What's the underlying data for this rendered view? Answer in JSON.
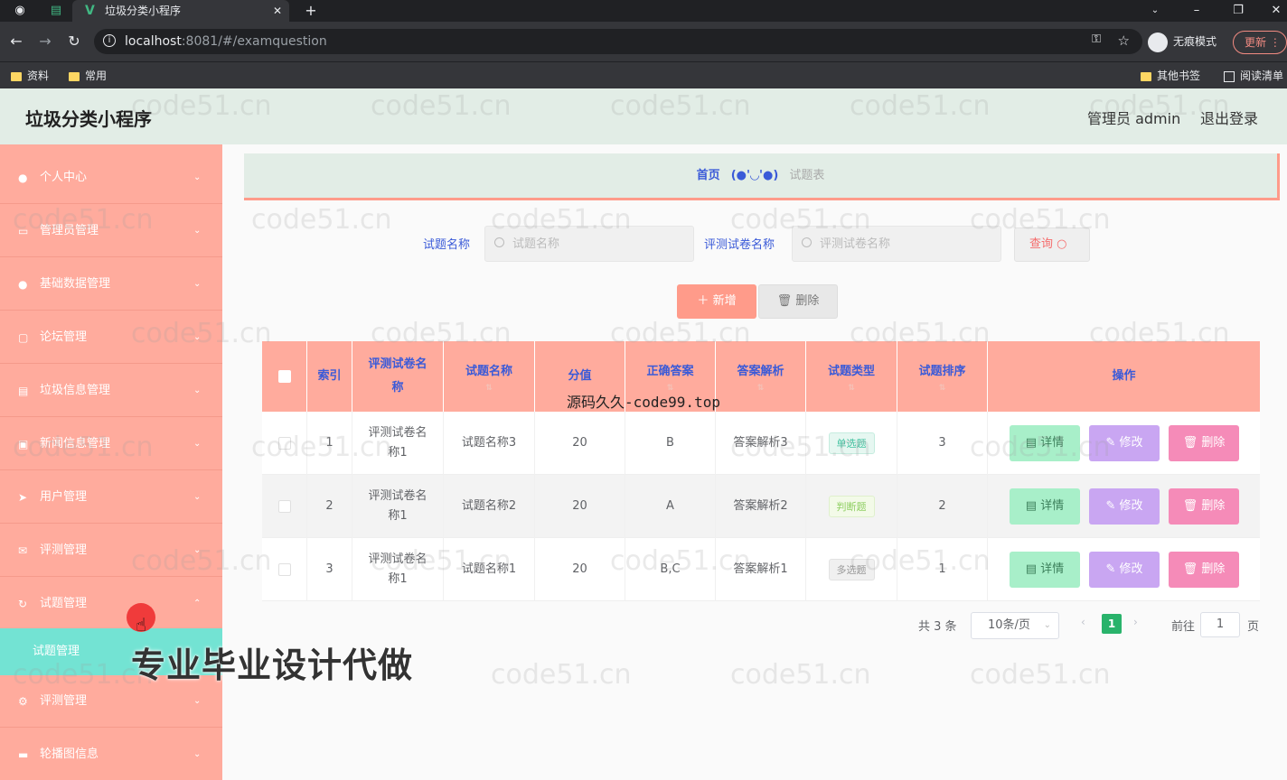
{
  "browser": {
    "tab_title": "垃圾分类小程序",
    "url_host": "localhost",
    "url_rest": ":8081/#/examquestion",
    "incognito_label": "无痕模式",
    "update_label": "更新",
    "bookmarks": [
      "资料",
      "常用"
    ],
    "bookmarks_right": [
      "其他书签",
      "阅读清单"
    ]
  },
  "header": {
    "title": "垃圾分类小程序",
    "admin": "管理员 admin",
    "logout": "退出登录"
  },
  "sidebar": {
    "items": [
      {
        "label": "个人中心",
        "icon": "user-icon"
      },
      {
        "label": "管理员管理",
        "icon": "list-icon"
      },
      {
        "label": "基础数据管理",
        "icon": "user-icon"
      },
      {
        "label": "论坛管理",
        "icon": "chat-icon"
      },
      {
        "label": "垃圾信息管理",
        "icon": "trash-icon"
      },
      {
        "label": "新闻信息管理",
        "icon": "news-icon"
      },
      {
        "label": "用户管理",
        "icon": "send-icon"
      },
      {
        "label": "评测管理",
        "icon": "mail-icon"
      },
      {
        "label": "试题管理",
        "icon": "refresh-icon"
      },
      {
        "label": "评测管理",
        "icon": "gear-icon"
      },
      {
        "label": "轮播图信息",
        "icon": "image-icon"
      }
    ],
    "active_sub": "试题管理"
  },
  "breadcrumb": {
    "home": "首页",
    "kaomoji": "(●'◡'●)",
    "current": "试题表"
  },
  "search": {
    "label1": "试题名称",
    "placeholder1": "试题名称",
    "label2": "评测试卷名称",
    "placeholder2": "评测试卷名称",
    "query": "查询"
  },
  "actions": {
    "add": "新增",
    "delete": "删除"
  },
  "table": {
    "headers": [
      "索引",
      "评测试卷名称",
      "试题名称",
      "分值",
      "正确答案",
      "答案解析",
      "试题类型",
      "试题排序",
      "操作"
    ],
    "rows": [
      {
        "index": "1",
        "paper": "评测试卷名称1",
        "name": "试题名称3",
        "score": "20",
        "answer": "B",
        "analysis": "答案解析3",
        "type": "单选题",
        "order": "3"
      },
      {
        "index": "2",
        "paper": "评测试卷名称1",
        "name": "试题名称2",
        "score": "20",
        "answer": "A",
        "analysis": "答案解析2",
        "type": "判断题",
        "order": "2"
      },
      {
        "index": "3",
        "paper": "评测试卷名称1",
        "name": "试题名称1",
        "score": "20",
        "answer": "B,C",
        "analysis": "答案解析1",
        "type": "多选题",
        "order": "1"
      }
    ],
    "ops": {
      "detail": "详情",
      "edit": "修改",
      "delete": "删除"
    }
  },
  "pagination": {
    "total": "共 3 条",
    "page_size": "10条/页",
    "current": "1",
    "goto": "前往",
    "goto_value": "1",
    "page_suffix": "页"
  },
  "overlays": {
    "site_text": "源码久久-code99.top",
    "banner": "专业毕业设计代做",
    "watermark": "code51.cn"
  },
  "colors": {
    "header_bg": "#e2ede6",
    "sidebar_bg": "#ffab9d",
    "submenu_active": "#73e3d3",
    "accent_blue": "#3a5ad8",
    "page_active": "#29b36b"
  }
}
